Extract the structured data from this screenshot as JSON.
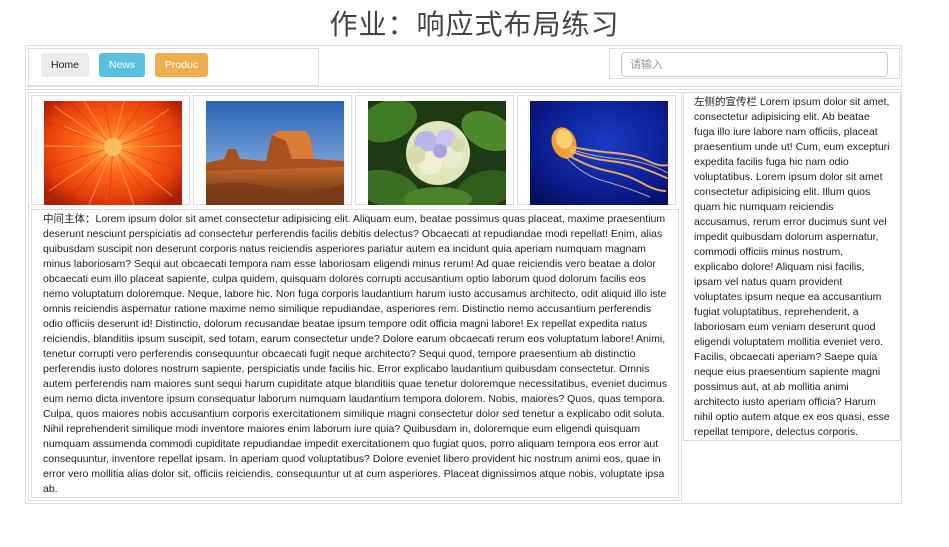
{
  "page": {
    "title": "作业：响应式布局练习"
  },
  "nav": {
    "buttons": [
      {
        "label": "Home",
        "color": "#ececec"
      },
      {
        "label": "News",
        "color": "#5bc0de"
      },
      {
        "label": "Produc",
        "color": "#f0ad4e"
      }
    ]
  },
  "search": {
    "placeholder": "请输入",
    "value": ""
  },
  "images": [
    {
      "icon": "chrysanthemum-photo"
    },
    {
      "icon": "desert-butte-photo"
    },
    {
      "icon": "hydrangea-photo"
    },
    {
      "icon": "jellyfish-photo"
    }
  ],
  "main": {
    "text": "中间主体：Lorem ipsum dolor sit amet consectetur adipisicing elit. Aliquam eum, beatae possimus quas placeat, maxime praesentium deserunt nesciunt perspiciatis ad consectetur perferendis facilis debitis delectus? Obcaecati at repudiandae modi repellat! Enim, alias quibusdam suscipit non deserunt corporis natus reiciendis asperiores pariatur autem ea incidunt quia aperiam numquam magnam minus laboriosam? Sequi aut obcaecati tempora nam esse laboriosam eligendi minus rerum! Ad quae reiciendis vero beatae a dolor obcaecati eum illo placeat sapiente, culpa quidem, quisquam dolores corrupti accusantium optio laborum quod dolorum facilis eos nemo voluptatum doloremque. Neque, labore hic. Non fuga corporis laudantium harum iusto accusamus architecto, odit aliquid illo iste omnis reiciendis aspernatur ratione maxime nemo similique repudiandae, asperiores rem. Distinctio nemo accusantium perferendis odio officiis deserunt id! Distinctio, dolorum recusandae beatae ipsum tempore odit officia magni labore! Ex repellat expedita natus reiciendis, blanditiis ipsum suscipit, sed totam, earum consectetur unde? Dolore earum obcaecati rerum eos voluptatum labore! Animi, tenetur corrupti vero perferendis consequuntur obcaecati fugit neque architecto? Sequi quod, tempore praesentium ab distinctio perferendis iusto dolores nostrum sapiente, perspiciatis unde facilis hic. Error explicabo laudantium quibusdam consectetur. Omnis autem perferendis nam maiores sunt sequi harum cupiditate atque blanditiis quae tenetur doloremque necessitatibus, eveniet ducimus eum nemo dicta inventore ipsum consequatur laborum numquam laudantium tempora dolorem. Nobis, maiores? Quos, quas tempora. Culpa, quos maiores nobis accusantium corporis exercitationem similique magni consectetur dolor sed tenetur a explicabo odit soluta. Nihil reprehenderit similique modi inventore maiores enim laborum iure quia? Quibusdam in, doloremque eum eligendi quisquam numquam assumenda commodi cupiditate repudiandae impedit exercitationem quo fugiat quos, porro aliquam tempora eos error aut consequuntur, inventore repellat ipsam. In aperiam quod voluptatibus? Dolore eveniet libero provident hic nostrum animi eos, quae in error vero mollitia alias dolor sit, officiis reiciendis, consequuntur ut at cum asperiores. Placeat dignissimos atque nobis, voluptate ipsa ab."
  },
  "sidebar": {
    "text": "左侧的宣传栏 Lorem ipsum dolor sit amet, consectetur adipisicing elit. Ab beatae fuga illo iure labore nam officiis, placeat praesentium unde ut! Cum, eum excepturi expedita facilis fuga hic nam odio voluptatibus. Lorem ipsum dolor sit amet consectetur adipisicing elit. Illum quos quam hic numquam reiciendis accusamus, rerum error ducimus sunt vel impedit quibusdam dolorum aspernatur, commodi officiis minus nostrum, explicabo dolore! Aliquam nisi facilis, ipsam vel natus quam provident voluptates ipsum neque ea accusantium fugiat voluptatibus, reprehenderit, a laboriosam eum veniam deserunt quod eligendi voluptatem mollitia eveniet vero. Facilis, obcaecati aperiam? Saepe quia neque eius praesentium sapiente magni possimus aut, at ab mollitia animi architecto iusto aperiam officia? Harum nihil optio autem atque ex eos quasi, esse repellat tempore, delectus corporis."
  },
  "colors": {
    "border": "#dddddd",
    "news_button": "#5bc0de",
    "product_button": "#f0ad4e",
    "home_button": "#ececec"
  }
}
